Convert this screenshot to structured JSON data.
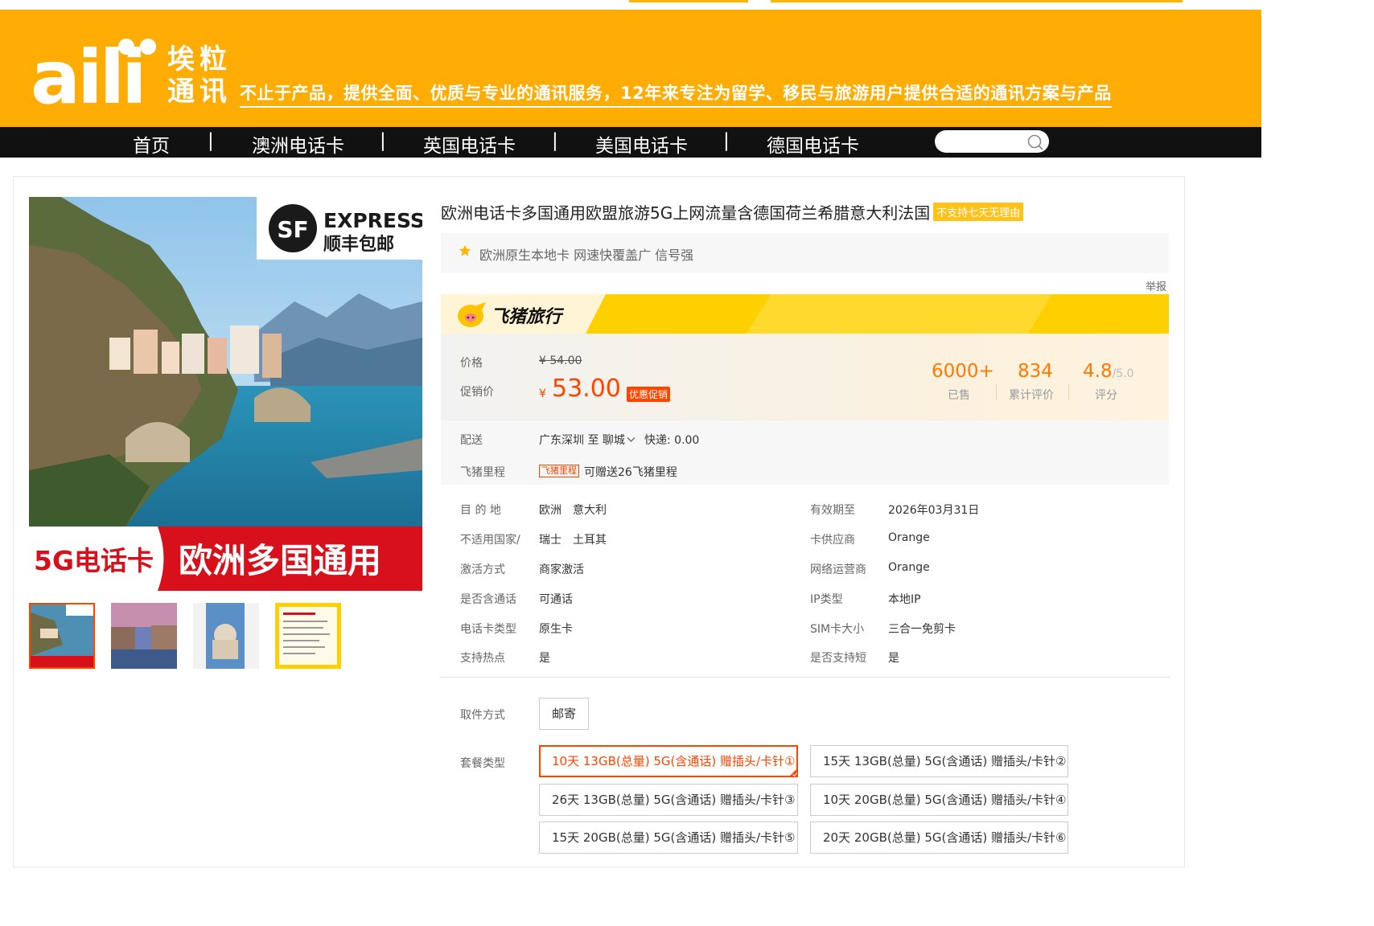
{
  "brand": {
    "logo_text": "aili",
    "name_line1": "埃粒",
    "name_line2": "通讯",
    "slogan": "不止于产品，提供全面、优质与专业的通讯服务，12年来专注为留学、移民与旅游用户提供合适的通讯方案与产品"
  },
  "nav": {
    "items": [
      "首页",
      "澳洲电话卡",
      "英国电话卡",
      "美国电话卡",
      "德国电话卡"
    ],
    "separator": "|"
  },
  "main_image": {
    "sf_express": "EXPRESS",
    "sf_logo": "SF",
    "sf_free_shipping": "顺丰包邮",
    "banner_left": "5G电话卡",
    "banner_right": "欧洲多国通用"
  },
  "product": {
    "title": "欧洲电话卡多国通用欧盟旅游5G上网流量含德国荷兰希腊意大利法国",
    "title_badge": "不支持七天无理由",
    "subtitle": "欧洲原生本地卡 网速快覆盖广 信号强",
    "report": "举报",
    "fliggy_brand": "飞猪旅行"
  },
  "pricing": {
    "price_label": "价格",
    "old_price": "¥ 54.00",
    "promo_label": "促销价",
    "currency": "¥",
    "promo_price": "53.00",
    "promo_tag": "优惠促销",
    "stats": [
      {
        "value": "6000+",
        "suffix": "",
        "label": "已售"
      },
      {
        "value": "834",
        "suffix": "",
        "label": "累计评价"
      },
      {
        "value": "4.8",
        "suffix": "/5.0",
        "label": "评分"
      }
    ]
  },
  "shipping": {
    "delivery_label": "配送",
    "delivery_value": "广东深圳 至 聊城",
    "express_value": "快递: 0.00",
    "mileage_label": "飞猪里程",
    "mileage_tag": "飞猪里程",
    "mileage_value": "可赠送26飞猪里程"
  },
  "attributes": {
    "left": [
      {
        "label": "目 的 地",
        "value": "欧洲　意大利"
      },
      {
        "label": "不适用国家/",
        "value": "瑞士　土耳其"
      },
      {
        "label": "激活方式",
        "value": "商家激活"
      },
      {
        "label": "是否含通话",
        "value": "可通话"
      },
      {
        "label": "电话卡类型",
        "value": "原生卡"
      },
      {
        "label": "支持热点",
        "value": "是"
      }
    ],
    "right": [
      {
        "label": "有效期至",
        "value": "2026年03月31日"
      },
      {
        "label": "卡供应商",
        "value": "Orange"
      },
      {
        "label": "网络运营商",
        "value": "Orange"
      },
      {
        "label": "IP类型",
        "value": "本地IP"
      },
      {
        "label": "SIM卡大小",
        "value": "三合一免剪卡"
      },
      {
        "label": "是否支持短",
        "value": "是"
      }
    ]
  },
  "options": {
    "pickup_label": "取件方式",
    "pickup_value": "邮寄",
    "package_label": "套餐类型",
    "packages": [
      "10天 13GB(总量) 5G(含通话) 赠插头/卡针①",
      "15天 13GB(总量) 5G(含通话) 赠插头/卡针②",
      "26天 13GB(总量) 5G(含通话) 赠插头/卡针③",
      "10天 20GB(总量) 5G(含通话) 赠插头/卡针④",
      "15天 20GB(总量) 5G(含通话) 赠插头/卡针⑤",
      "20天 20GB(总量) 5G(含通话) 赠插头/卡针⑥"
    ],
    "selected_index": 0
  },
  "colors": {
    "brand_orange": "#ffad05",
    "price_red": "#ff4400",
    "stat_orange": "#ff7a00",
    "nav_black": "#111111",
    "fliggy_yellow": "#ffd000"
  }
}
